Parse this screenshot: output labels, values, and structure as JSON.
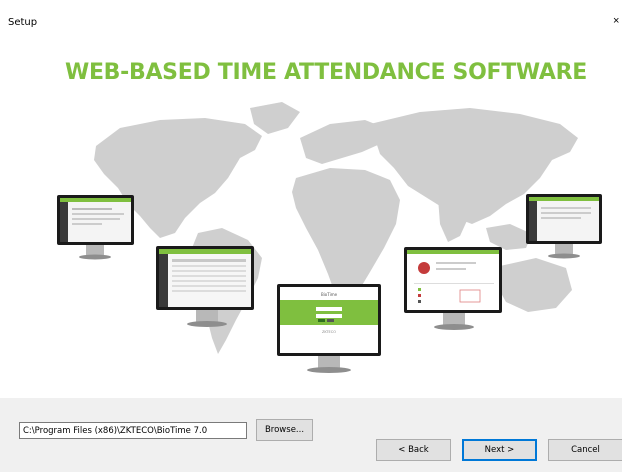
{
  "window": {
    "title": "Setup",
    "close_glyph": "×"
  },
  "hero": {
    "headline": "WEB-BASED TIME ATTENDANCE SOFTWARE",
    "accent_color": "#7fbf3f",
    "map_color": "#cfcfcf",
    "monitor_screens": [
      {
        "name": "monitor-far-left",
        "content": "list view"
      },
      {
        "name": "monitor-left",
        "content": "table report"
      },
      {
        "name": "monitor-center",
        "content": "login page",
        "brand": "BioTime",
        "footer": "ZKTECO"
      },
      {
        "name": "monitor-right",
        "content": "dashboard"
      },
      {
        "name": "monitor-far-right",
        "content": "list view"
      }
    ]
  },
  "install": {
    "path_value": "C:\\Program Files (x86)\\ZKTECO\\BioTime 7.0",
    "browse_label": "Browse..."
  },
  "nav": {
    "back_label": "< Back",
    "next_label": "Next >",
    "cancel_label": "Cancel"
  }
}
